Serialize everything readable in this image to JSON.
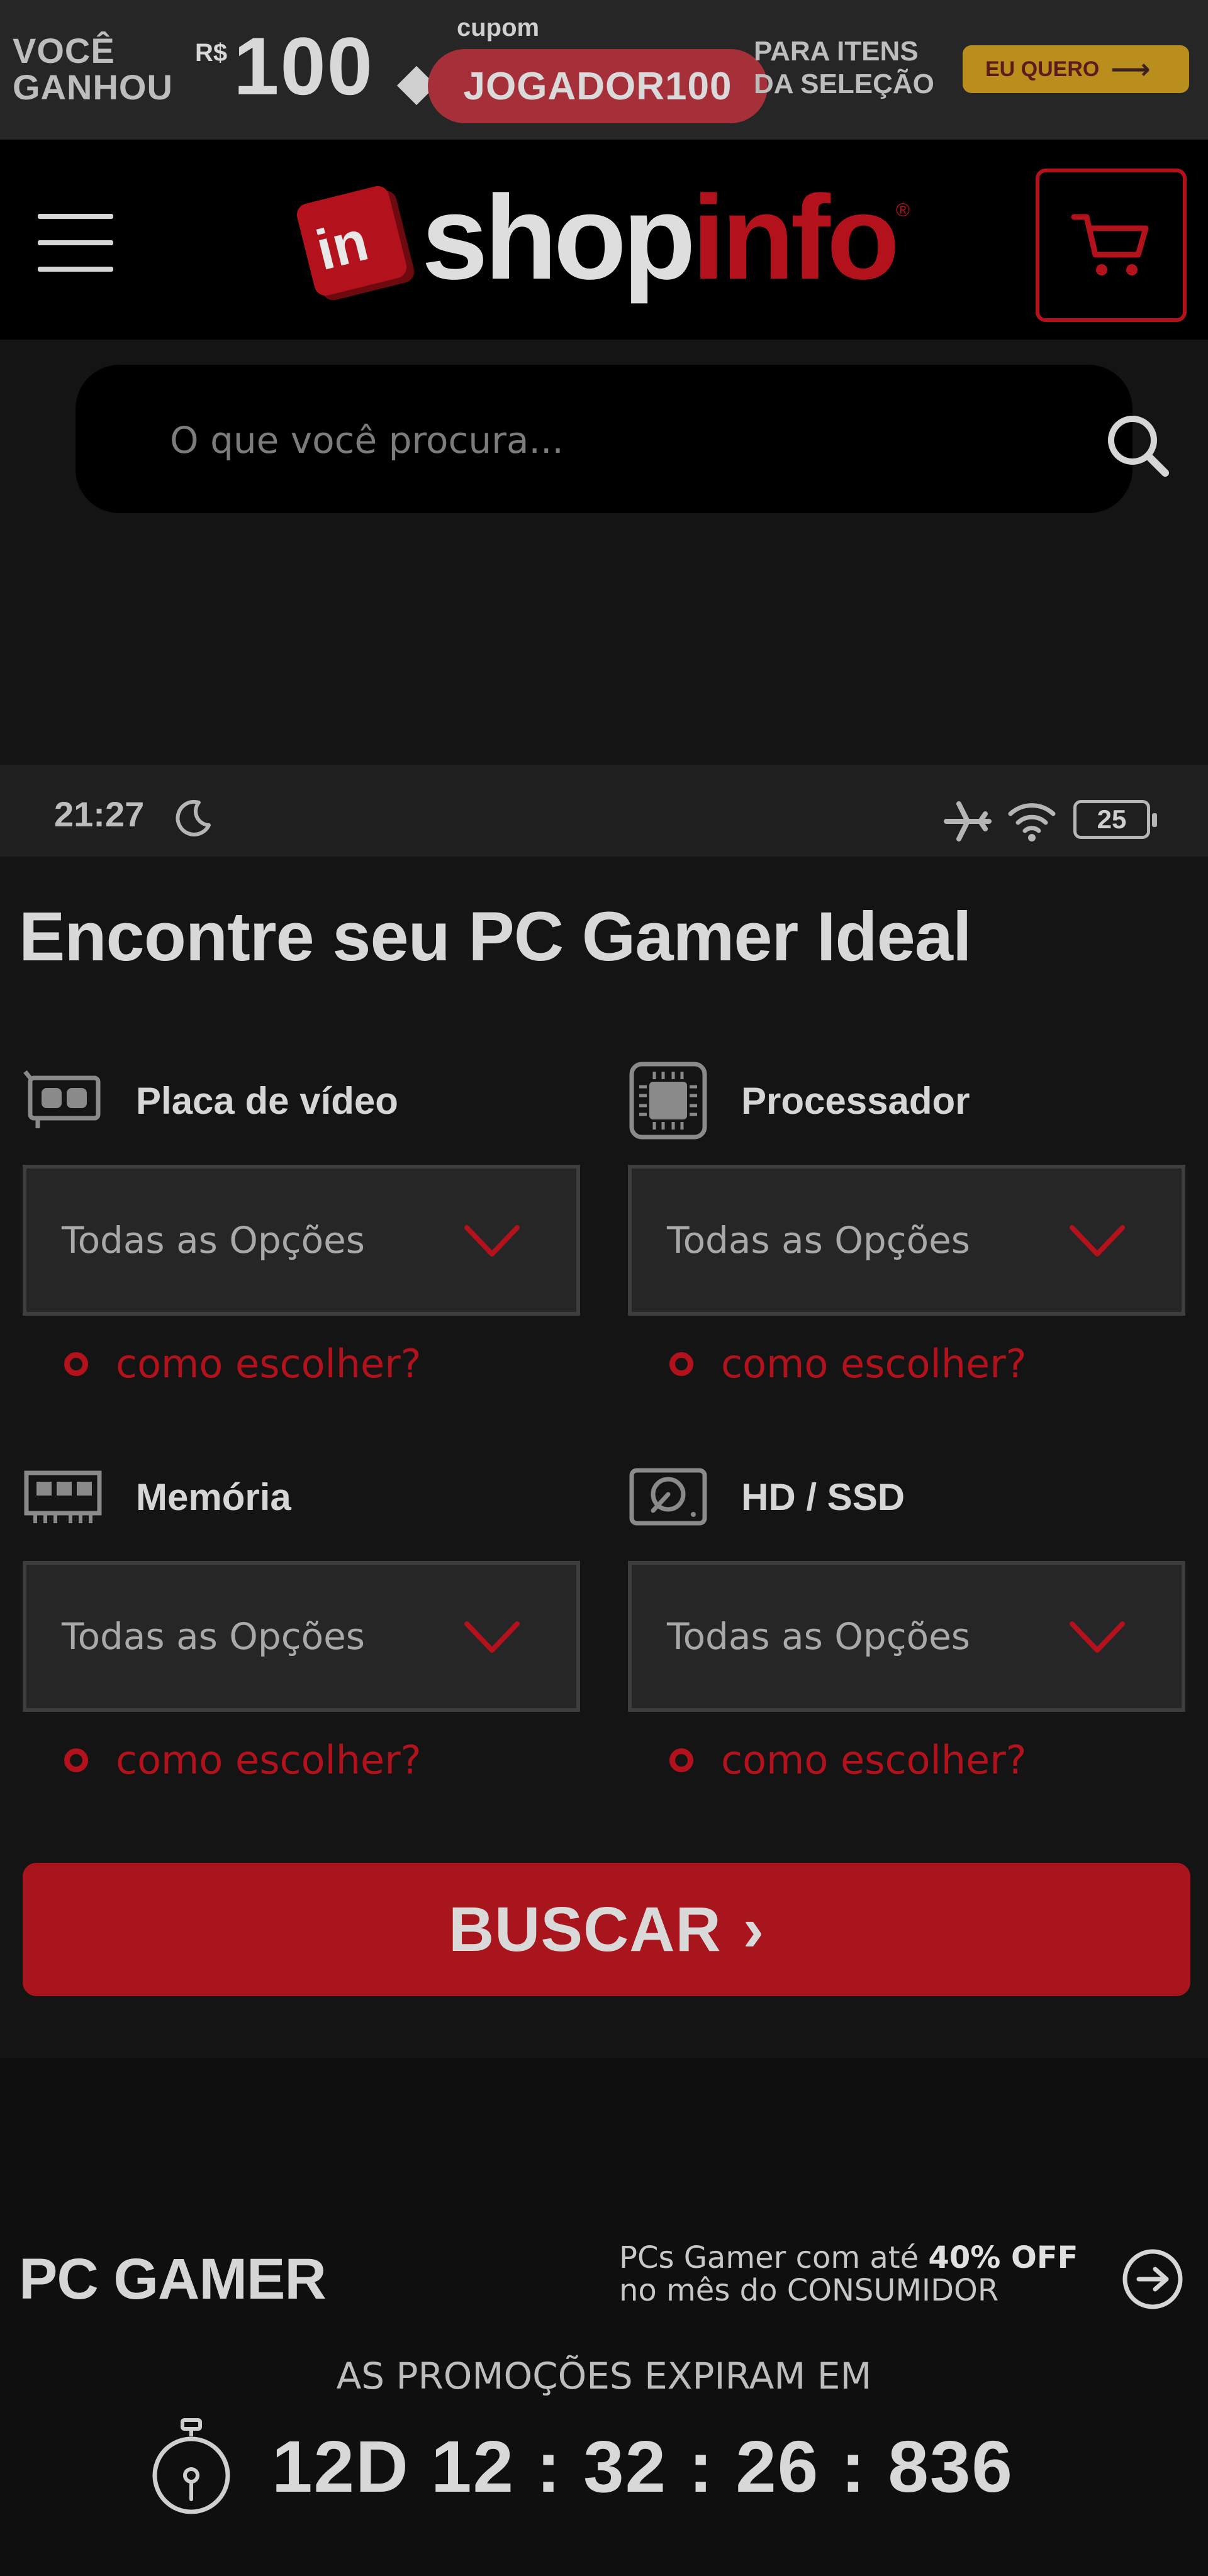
{
  "promo": {
    "won_line1": "VOCÊ",
    "won_line2": "GANHOU",
    "currency": "R$",
    "amount": "100",
    "coupon_label": "cupom",
    "coupon_code": "JOGADOR100",
    "items_line1": "PARA ITENS",
    "items_line2": "DA SELEÇÃO",
    "cta_label": "EU QUERO"
  },
  "header": {
    "logo_part1": "shop",
    "logo_part2": "info",
    "logo_mark": "in"
  },
  "search": {
    "placeholder": "O que você procura..."
  },
  "statusbar": {
    "time": "21:27",
    "battery": "25"
  },
  "finder": {
    "title": "Encontre seu PC Gamer Ideal",
    "fields": [
      {
        "label": "Placa de vídeo",
        "value": "Todas as Opções",
        "help": "como escolher?"
      },
      {
        "label": "Processador",
        "value": "Todas as Opções",
        "help": "como escolher?"
      },
      {
        "label": "Memória",
        "value": "Todas as Opções",
        "help": "como escolher?"
      },
      {
        "label": "HD / SSD",
        "value": "Todas as Opções",
        "help": "como escolher?"
      }
    ],
    "search_button": "BUSCAR",
    "search_button_arrow": "›"
  },
  "pcgamer": {
    "title": "PC GAMER",
    "promo_prefix": "PCs Gamer com até",
    "promo_bold": "40% OFF",
    "promo_suffix": "no mês do CONSUMIDOR",
    "expire_label": "AS PROMOÇÕES EXPIRAM EM",
    "timer": "12D 12 : 32 : 26 : 836"
  },
  "colors": {
    "brand_red": "#b3121d",
    "promo_yellow": "#b98e1c",
    "background": "#141414"
  },
  "icons": [
    "menu-icon",
    "cart-icon",
    "search-icon",
    "moon-icon",
    "airplane-icon",
    "wifi-icon",
    "gpu-icon",
    "cpu-icon",
    "ram-icon",
    "hdd-icon",
    "chevron-down-icon",
    "arrow-circle-right-icon",
    "stopwatch-icon"
  ]
}
